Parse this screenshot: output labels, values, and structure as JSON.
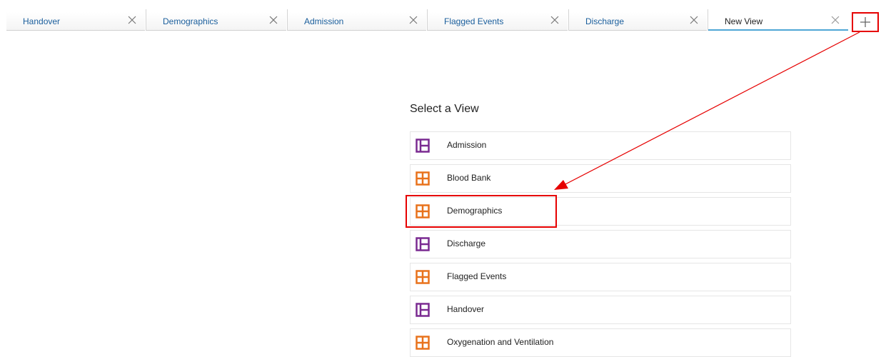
{
  "tabs": [
    {
      "label": "Handover",
      "active": false
    },
    {
      "label": "Demographics",
      "active": false
    },
    {
      "label": "Admission",
      "active": false
    },
    {
      "label": "Flagged Events",
      "active": false
    },
    {
      "label": "Discharge",
      "active": false
    },
    {
      "label": "New View",
      "active": true
    }
  ],
  "panel": {
    "title": "Select a View",
    "items": [
      {
        "label": "Admission",
        "icon": "layout-sidebar-icon",
        "color": "#7a2a91"
      },
      {
        "label": "Blood Bank",
        "icon": "layout-grid-icon",
        "color": "#e8721c"
      },
      {
        "label": "Demographics",
        "icon": "layout-grid-icon",
        "color": "#e8721c"
      },
      {
        "label": "Discharge",
        "icon": "layout-sidebar-icon",
        "color": "#7a2a91"
      },
      {
        "label": "Flagged Events",
        "icon": "layout-grid-icon",
        "color": "#e8721c"
      },
      {
        "label": "Handover",
        "icon": "layout-sidebar-icon",
        "color": "#7a2a91"
      },
      {
        "label": "Oxygenation and Ventilation",
        "icon": "layout-grid-icon",
        "color": "#e8721c"
      }
    ]
  },
  "colors": {
    "tab_link": "#1a5e9c",
    "active_underline": "#4fa7d6",
    "annotation": "#e60000"
  }
}
